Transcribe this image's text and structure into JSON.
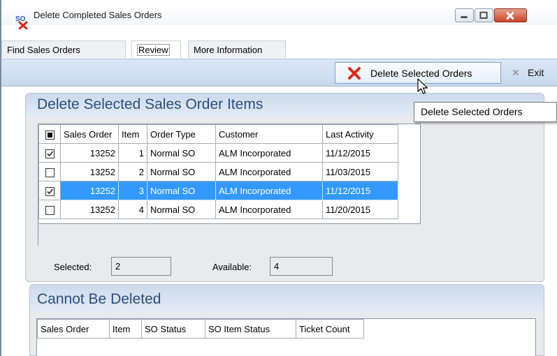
{
  "window": {
    "title": "Delete Completed Sales Orders",
    "app_icon": "so-delete-icon"
  },
  "tabs": [
    {
      "label": "Find Sales Orders"
    },
    {
      "label": "Review",
      "active": true
    },
    {
      "label": "More Information"
    }
  ],
  "toolbar": {
    "delete_label": "Delete Selected Orders",
    "exit_label": "Exit"
  },
  "tooltip": "Delete Selected Orders",
  "section1": {
    "title": "Delete Selected Sales Order Items",
    "columns": [
      "Sales Order",
      "Item",
      "Order Type",
      "Customer",
      "Last Activity"
    ],
    "rows": [
      {
        "checked": true,
        "sales_order": "13252",
        "item": "1",
        "order_type": "Normal SO",
        "customer": "ALM Incorporated",
        "last_activity": "11/12/2015",
        "selected": false
      },
      {
        "checked": false,
        "sales_order": "13252",
        "item": "2",
        "order_type": "Normal SO",
        "customer": "ALM Incorporated",
        "last_activity": "11/03/2015",
        "selected": false
      },
      {
        "checked": true,
        "sales_order": "13252",
        "item": "3",
        "order_type": "Normal SO",
        "customer": "ALM Incorporated",
        "last_activity": "11/12/2015",
        "selected": true
      },
      {
        "checked": false,
        "sales_order": "13252",
        "item": "4",
        "order_type": "Normal SO",
        "customer": "ALM Incorporated",
        "last_activity": "11/20/2015",
        "selected": false
      }
    ],
    "selected_label": "Selected:",
    "selected_value": "2",
    "available_label": "Available:",
    "available_value": "4"
  },
  "section2": {
    "title": "Cannot Be Deleted",
    "columns": [
      "Sales Order",
      "Item",
      "SO Status",
      "SO Item Status",
      "Ticket Count"
    ]
  },
  "colors": {
    "accent": "#3399ff",
    "panel_title": "#2b4f7f",
    "close_button": "#c8452a"
  }
}
